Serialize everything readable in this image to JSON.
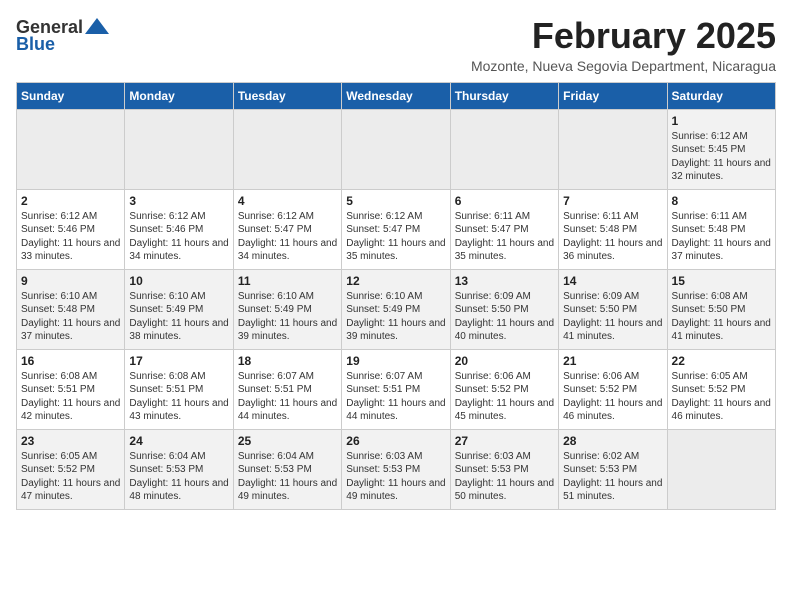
{
  "header": {
    "logo_general": "General",
    "logo_blue": "Blue",
    "month_title": "February 2025",
    "location": "Mozonte, Nueva Segovia Department, Nicaragua"
  },
  "weekdays": [
    "Sunday",
    "Monday",
    "Tuesday",
    "Wednesday",
    "Thursday",
    "Friday",
    "Saturday"
  ],
  "weeks": [
    [
      {
        "day": "",
        "empty": true
      },
      {
        "day": "",
        "empty": true
      },
      {
        "day": "",
        "empty": true
      },
      {
        "day": "",
        "empty": true
      },
      {
        "day": "",
        "empty": true
      },
      {
        "day": "",
        "empty": true
      },
      {
        "day": "1",
        "sunrise": "Sunrise: 6:12 AM",
        "sunset": "Sunset: 5:45 PM",
        "daylight": "Daylight: 11 hours and 32 minutes."
      }
    ],
    [
      {
        "day": "2",
        "sunrise": "Sunrise: 6:12 AM",
        "sunset": "Sunset: 5:46 PM",
        "daylight": "Daylight: 11 hours and 33 minutes."
      },
      {
        "day": "3",
        "sunrise": "Sunrise: 6:12 AM",
        "sunset": "Sunset: 5:46 PM",
        "daylight": "Daylight: 11 hours and 34 minutes."
      },
      {
        "day": "4",
        "sunrise": "Sunrise: 6:12 AM",
        "sunset": "Sunset: 5:47 PM",
        "daylight": "Daylight: 11 hours and 34 minutes."
      },
      {
        "day": "5",
        "sunrise": "Sunrise: 6:12 AM",
        "sunset": "Sunset: 5:47 PM",
        "daylight": "Daylight: 11 hours and 35 minutes."
      },
      {
        "day": "6",
        "sunrise": "Sunrise: 6:11 AM",
        "sunset": "Sunset: 5:47 PM",
        "daylight": "Daylight: 11 hours and 35 minutes."
      },
      {
        "day": "7",
        "sunrise": "Sunrise: 6:11 AM",
        "sunset": "Sunset: 5:48 PM",
        "daylight": "Daylight: 11 hours and 36 minutes."
      },
      {
        "day": "8",
        "sunrise": "Sunrise: 6:11 AM",
        "sunset": "Sunset: 5:48 PM",
        "daylight": "Daylight: 11 hours and 37 minutes."
      }
    ],
    [
      {
        "day": "9",
        "sunrise": "Sunrise: 6:10 AM",
        "sunset": "Sunset: 5:48 PM",
        "daylight": "Daylight: 11 hours and 37 minutes."
      },
      {
        "day": "10",
        "sunrise": "Sunrise: 6:10 AM",
        "sunset": "Sunset: 5:49 PM",
        "daylight": "Daylight: 11 hours and 38 minutes."
      },
      {
        "day": "11",
        "sunrise": "Sunrise: 6:10 AM",
        "sunset": "Sunset: 5:49 PM",
        "daylight": "Daylight: 11 hours and 39 minutes."
      },
      {
        "day": "12",
        "sunrise": "Sunrise: 6:10 AM",
        "sunset": "Sunset: 5:49 PM",
        "daylight": "Daylight: 11 hours and 39 minutes."
      },
      {
        "day": "13",
        "sunrise": "Sunrise: 6:09 AM",
        "sunset": "Sunset: 5:50 PM",
        "daylight": "Daylight: 11 hours and 40 minutes."
      },
      {
        "day": "14",
        "sunrise": "Sunrise: 6:09 AM",
        "sunset": "Sunset: 5:50 PM",
        "daylight": "Daylight: 11 hours and 41 minutes."
      },
      {
        "day": "15",
        "sunrise": "Sunrise: 6:08 AM",
        "sunset": "Sunset: 5:50 PM",
        "daylight": "Daylight: 11 hours and 41 minutes."
      }
    ],
    [
      {
        "day": "16",
        "sunrise": "Sunrise: 6:08 AM",
        "sunset": "Sunset: 5:51 PM",
        "daylight": "Daylight: 11 hours and 42 minutes."
      },
      {
        "day": "17",
        "sunrise": "Sunrise: 6:08 AM",
        "sunset": "Sunset: 5:51 PM",
        "daylight": "Daylight: 11 hours and 43 minutes."
      },
      {
        "day": "18",
        "sunrise": "Sunrise: 6:07 AM",
        "sunset": "Sunset: 5:51 PM",
        "daylight": "Daylight: 11 hours and 44 minutes."
      },
      {
        "day": "19",
        "sunrise": "Sunrise: 6:07 AM",
        "sunset": "Sunset: 5:51 PM",
        "daylight": "Daylight: 11 hours and 44 minutes."
      },
      {
        "day": "20",
        "sunrise": "Sunrise: 6:06 AM",
        "sunset": "Sunset: 5:52 PM",
        "daylight": "Daylight: 11 hours and 45 minutes."
      },
      {
        "day": "21",
        "sunrise": "Sunrise: 6:06 AM",
        "sunset": "Sunset: 5:52 PM",
        "daylight": "Daylight: 11 hours and 46 minutes."
      },
      {
        "day": "22",
        "sunrise": "Sunrise: 6:05 AM",
        "sunset": "Sunset: 5:52 PM",
        "daylight": "Daylight: 11 hours and 46 minutes."
      }
    ],
    [
      {
        "day": "23",
        "sunrise": "Sunrise: 6:05 AM",
        "sunset": "Sunset: 5:52 PM",
        "daylight": "Daylight: 11 hours and 47 minutes."
      },
      {
        "day": "24",
        "sunrise": "Sunrise: 6:04 AM",
        "sunset": "Sunset: 5:53 PM",
        "daylight": "Daylight: 11 hours and 48 minutes."
      },
      {
        "day": "25",
        "sunrise": "Sunrise: 6:04 AM",
        "sunset": "Sunset: 5:53 PM",
        "daylight": "Daylight: 11 hours and 49 minutes."
      },
      {
        "day": "26",
        "sunrise": "Sunrise: 6:03 AM",
        "sunset": "Sunset: 5:53 PM",
        "daylight": "Daylight: 11 hours and 49 minutes."
      },
      {
        "day": "27",
        "sunrise": "Sunrise: 6:03 AM",
        "sunset": "Sunset: 5:53 PM",
        "daylight": "Daylight: 11 hours and 50 minutes."
      },
      {
        "day": "28",
        "sunrise": "Sunrise: 6:02 AM",
        "sunset": "Sunset: 5:53 PM",
        "daylight": "Daylight: 11 hours and 51 minutes."
      },
      {
        "day": "",
        "empty": true
      }
    ]
  ]
}
